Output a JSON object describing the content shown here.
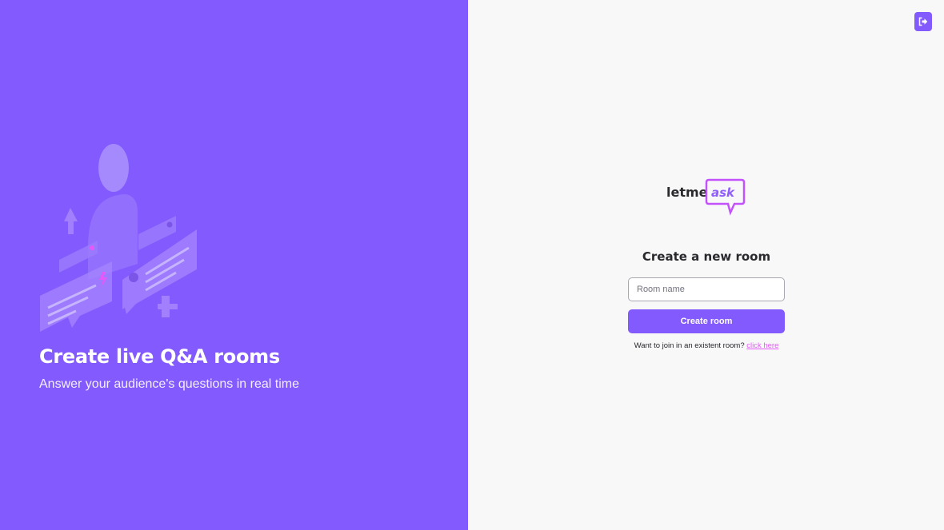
{
  "colors": {
    "primary": "#835afd",
    "accent_pink": "#e559f9",
    "background": "#f8f8f8",
    "text_dark": "#29292e"
  },
  "aside": {
    "illustration_icon": "qa-illustration",
    "title": "Create live Q&A rooms",
    "subtitle": "Answer your audience's questions in real time"
  },
  "header": {
    "logout_icon": "sign-out-icon"
  },
  "logo": {
    "text_main": "letme",
    "text_accent": "ask"
  },
  "form": {
    "title": "Create a new room",
    "room_name_placeholder": "Room name",
    "room_name_value": "",
    "submit_label": "Create room"
  },
  "join": {
    "text": "Want to join in an existent room?",
    "link_label": "click here"
  }
}
